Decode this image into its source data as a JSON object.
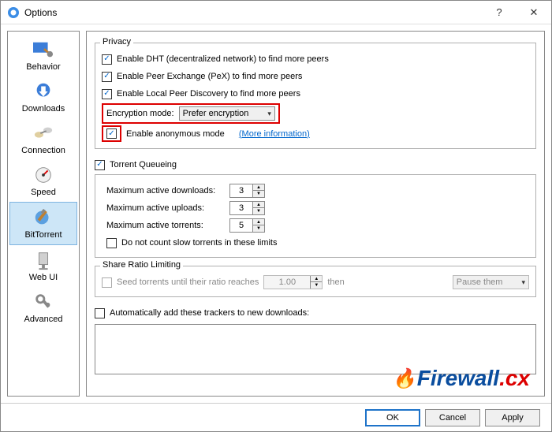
{
  "window": {
    "title": "Options"
  },
  "sidebar": {
    "items": [
      {
        "label": "Behavior"
      },
      {
        "label": "Downloads"
      },
      {
        "label": "Connection"
      },
      {
        "label": "Speed"
      },
      {
        "label": "BitTorrent"
      },
      {
        "label": "Web UI"
      },
      {
        "label": "Advanced"
      }
    ]
  },
  "privacy": {
    "legend": "Privacy",
    "dht": "Enable DHT (decentralized network) to find more peers",
    "pex": "Enable Peer Exchange (PeX) to find more peers",
    "lpd": "Enable Local Peer Discovery to find more peers",
    "enc_label": "Encryption mode:",
    "enc_value": "Prefer encryption",
    "anon": "Enable anonymous mode",
    "more_info": "(More information)"
  },
  "queue": {
    "legend": "Torrent Queueing",
    "max_dl": "Maximum active downloads:",
    "max_dl_val": "3",
    "max_up": "Maximum active uploads:",
    "max_up_val": "3",
    "max_t": "Maximum active torrents:",
    "max_t_val": "5",
    "slow": "Do not count slow torrents in these limits"
  },
  "ratio": {
    "legend": "Share Ratio Limiting",
    "seed": "Seed torrents until their ratio reaches",
    "seed_val": "1.00",
    "then": "then",
    "action": "Pause them"
  },
  "trackers": {
    "auto": "Automatically add these trackers to new downloads:"
  },
  "watermark": {
    "text": "Firewall",
    "suffix": ".cx"
  },
  "footer": {
    "ok": "OK",
    "cancel": "Cancel",
    "apply": "Apply"
  }
}
